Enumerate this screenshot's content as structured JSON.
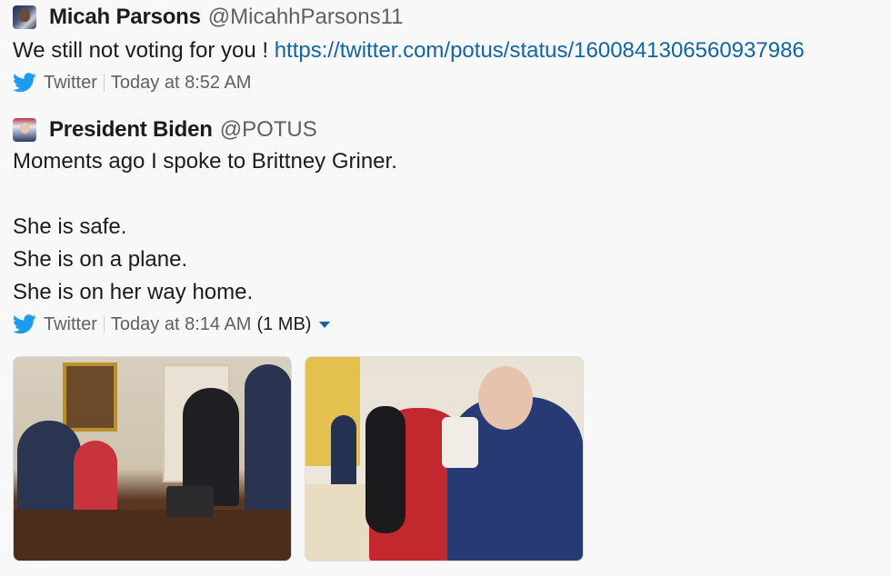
{
  "messages": [
    {
      "author": "Micah Parsons",
      "handle": "@MicahhParsons11",
      "text": "We still not voting for you ! ",
      "link": "https://twitter.com/potus/status/1600841306560937986",
      "source": "Twitter",
      "time": "Today at 8:52 AM"
    },
    {
      "author": "President Biden",
      "handle": "@POTUS",
      "paragraphs": [
        "Moments ago I spoke to Brittney Griner.",
        "",
        "She is safe.",
        "She is on a plane.",
        "She is on her way home."
      ],
      "source": "Twitter",
      "time": "Today at 8:14 AM",
      "size": "(1 MB)"
    }
  ],
  "icons": {
    "twitter": "twitter-bird-icon",
    "caret": "caret-down-icon"
  },
  "colors": {
    "link": "#1264a3",
    "twitter_blue": "#1d9bf0",
    "muted": "#616061",
    "background": "#f8f8f8"
  }
}
